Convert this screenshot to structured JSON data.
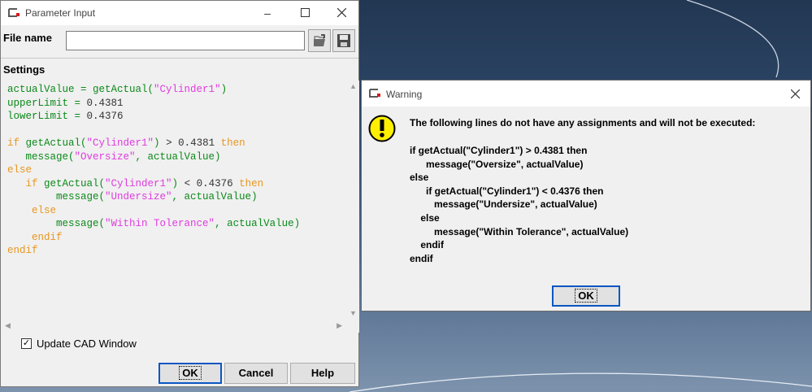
{
  "param_dialog": {
    "title": "Parameter Input",
    "file_name_label": "File name",
    "file_name_value": "",
    "settings_label": "Settings",
    "code_lines": [
      [
        {
          "t": "actualValue = ",
          "c": "v"
        },
        {
          "t": "getActual(",
          "c": "v"
        },
        {
          "t": "\"Cylinder1\"",
          "c": "s"
        },
        {
          "t": ")",
          "c": "v"
        }
      ],
      [
        {
          "t": "upperLimit = ",
          "c": "v"
        },
        {
          "t": "0.4381",
          "c": "n"
        }
      ],
      [
        {
          "t": "lowerLimit = ",
          "c": "v"
        },
        {
          "t": "0.4376",
          "c": "n"
        }
      ],
      [],
      [
        {
          "t": "if ",
          "c": "k"
        },
        {
          "t": "getActual(",
          "c": "v"
        },
        {
          "t": "\"Cylinder1\"",
          "c": "s"
        },
        {
          "t": ")",
          "c": "v"
        },
        {
          "t": " > ",
          "c": "n"
        },
        {
          "t": "0.4381",
          "c": "n"
        },
        {
          "t": " then",
          "c": "k"
        }
      ],
      [
        {
          "t": "   message(",
          "c": "v"
        },
        {
          "t": "\"Oversize\"",
          "c": "s"
        },
        {
          "t": ", actualValue)",
          "c": "v"
        }
      ],
      [
        {
          "t": "else",
          "c": "k"
        }
      ],
      [
        {
          "t": "   if ",
          "c": "k"
        },
        {
          "t": "getActual(",
          "c": "v"
        },
        {
          "t": "\"Cylinder1\"",
          "c": "s"
        },
        {
          "t": ")",
          "c": "v"
        },
        {
          "t": " < ",
          "c": "n"
        },
        {
          "t": "0.4376",
          "c": "n"
        },
        {
          "t": " then",
          "c": "k"
        }
      ],
      [
        {
          "t": "        message(",
          "c": "v"
        },
        {
          "t": "\"Undersize\"",
          "c": "s"
        },
        {
          "t": ", actualValue)",
          "c": "v"
        }
      ],
      [
        {
          "t": "    else",
          "c": "k"
        }
      ],
      [
        {
          "t": "        message(",
          "c": "v"
        },
        {
          "t": "\"Within Tolerance\"",
          "c": "s"
        },
        {
          "t": ", actualValue)",
          "c": "v"
        }
      ],
      [
        {
          "t": "    endif",
          "c": "k"
        }
      ],
      [
        {
          "t": "endif",
          "c": "k"
        }
      ]
    ],
    "update_cad_label": "Update CAD Window",
    "update_cad_checked": true,
    "ok_label": "OK",
    "cancel_label": "Cancel",
    "help_label": "Help"
  },
  "warning_dialog": {
    "title": "Warning",
    "message": "The following lines do not have any assignments and will not be executed:",
    "detail_lines": [
      "if getActual(\"Cylinder1\") > 0.4381 then",
      "      message(\"Oversize\", actualValue)",
      "else",
      "      if getActual(\"Cylinder1\") < 0.4376 then",
      "         message(\"Undersize\", actualValue)",
      "    else",
      "         message(\"Within Tolerance\", actualValue)",
      "    endif",
      "endif"
    ],
    "ok_label": "OK"
  },
  "colors": {
    "code_variable": "#0b8a19",
    "code_string": "#e03be0",
    "code_keyword": "#e8961f",
    "code_number": "#333333",
    "default_button_border": "#0a56c3",
    "warning_icon": "#ffef00"
  },
  "icons": {
    "app": "app-logo-icon",
    "open": "folder-open-icon",
    "save": "floppy-save-icon",
    "warning": "exclamation-icon"
  }
}
